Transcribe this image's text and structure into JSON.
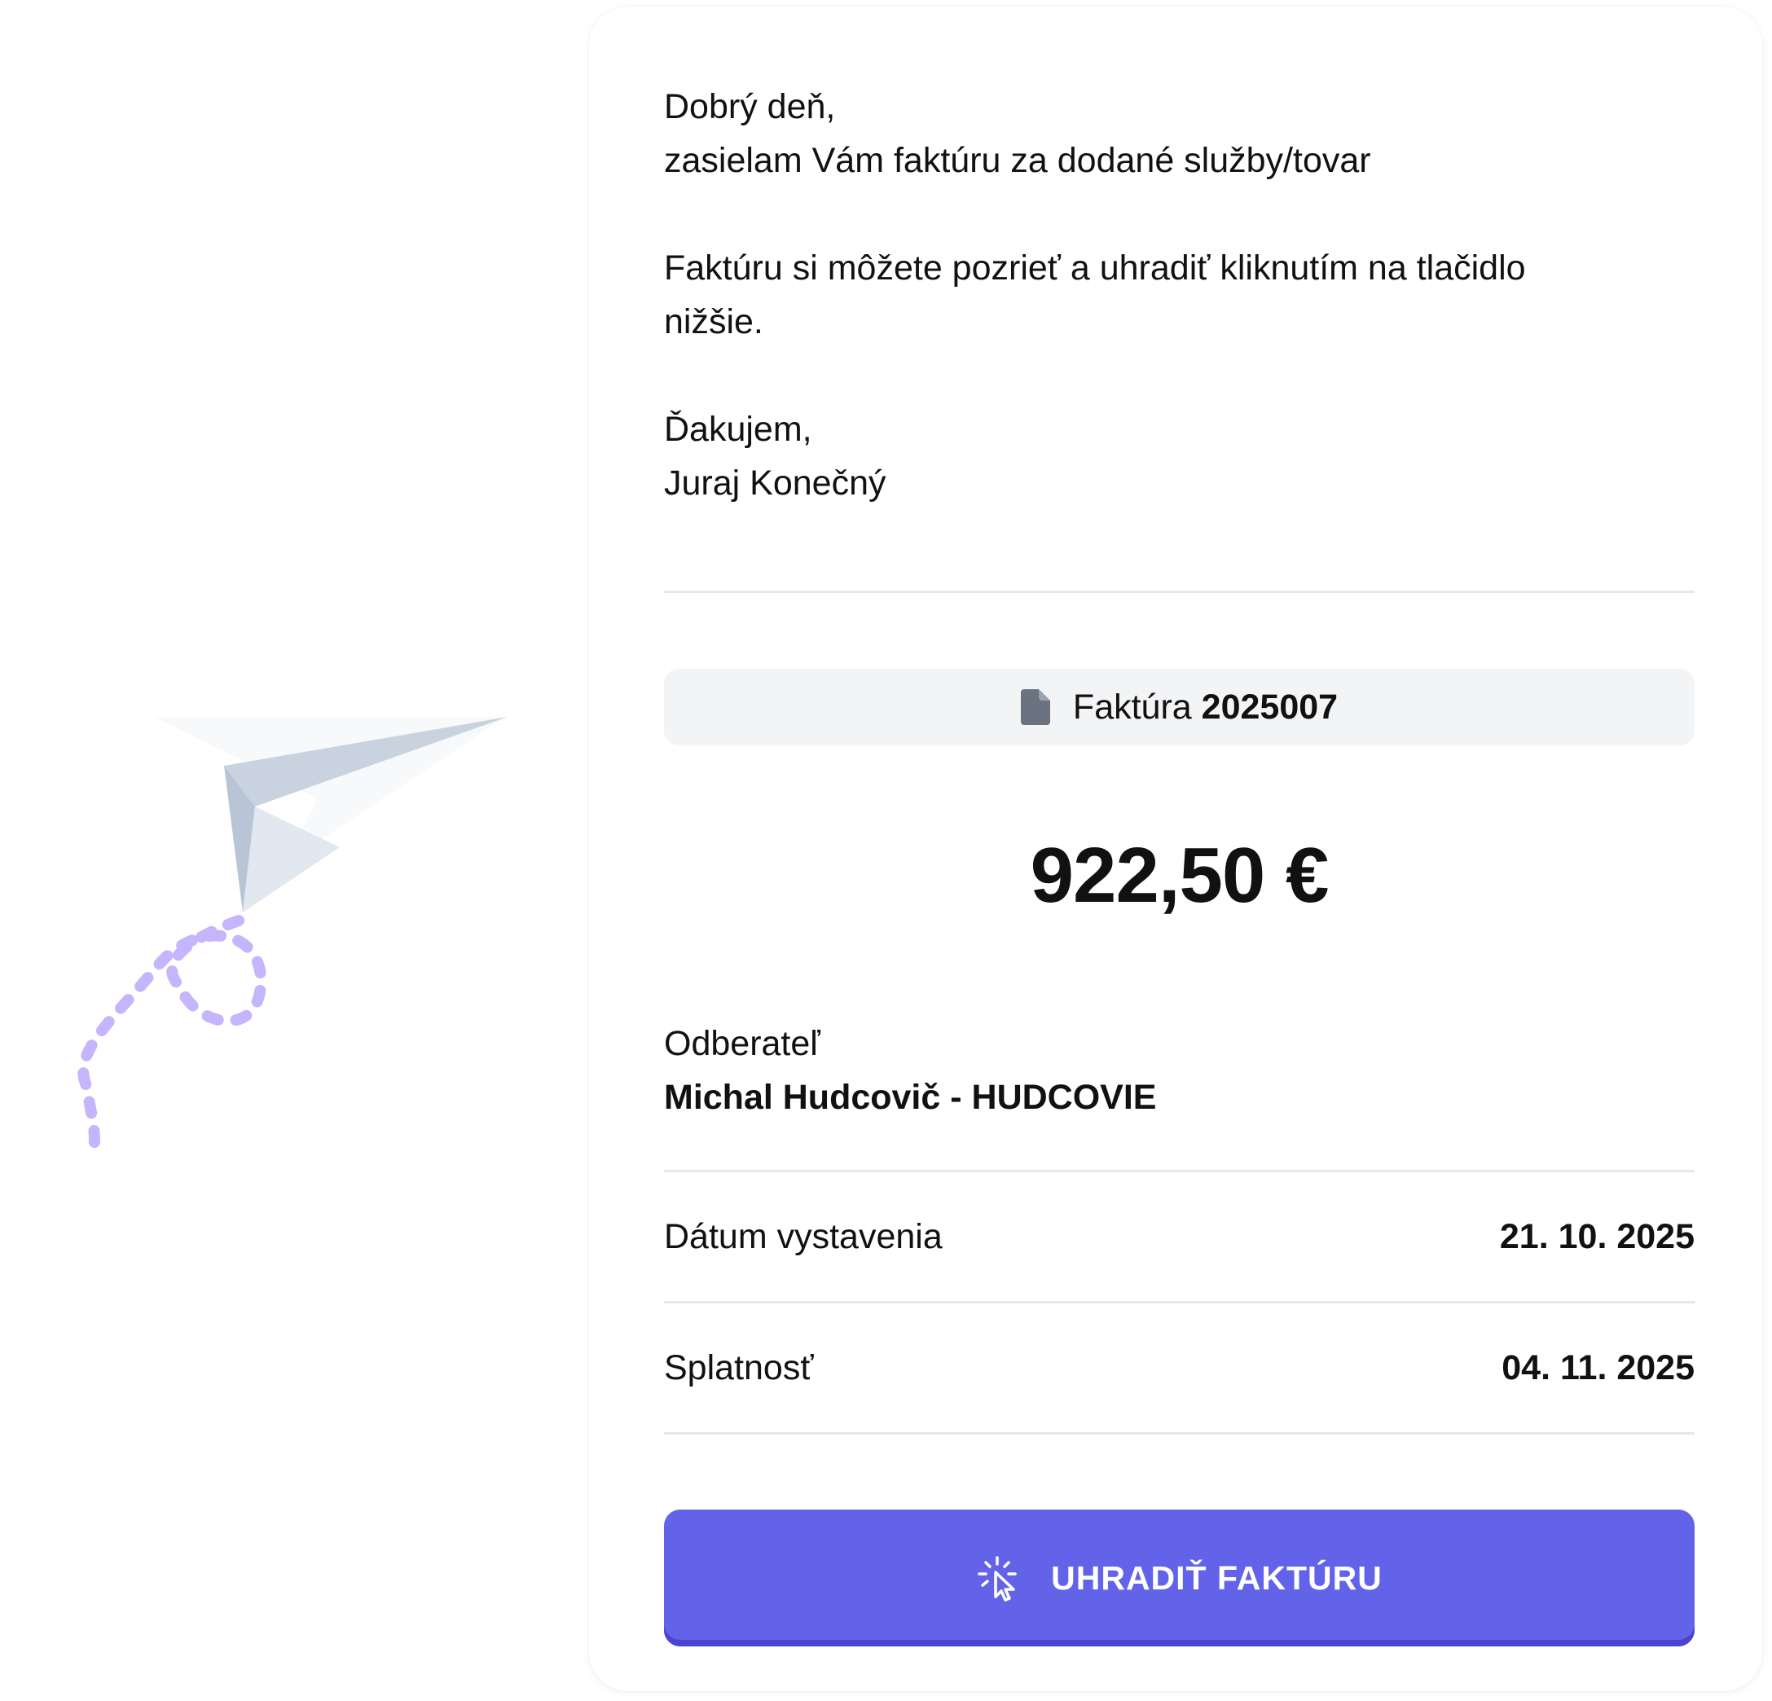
{
  "message": {
    "greeting": "Dobrý deň,",
    "line1": "zasielam Vám faktúru za dodané služby/tovar",
    "line2": "Faktúru si môžete pozrieť a uhradiť kliknutím na tlačidlo",
    "line3": "nižšie.",
    "thanks": "Ďakujem,",
    "sender": "Juraj Konečný"
  },
  "invoice": {
    "icon": "document-icon",
    "label": "Faktúra",
    "number": "2025007"
  },
  "amount": "922,50 €",
  "customer": {
    "label": "Odberateľ",
    "name": "Michal Hudcovič - HUDCOVIE"
  },
  "details": [
    {
      "label": "Dátum vystavenia",
      "value": "21. 10. 2025"
    },
    {
      "label": "Splatnosť",
      "value": "04. 11. 2025"
    }
  ],
  "pay_button": {
    "icon": "click-cursor-icon",
    "label": "UHRADIŤ FAKTÚRU"
  },
  "colors": {
    "accent": "#6363ea",
    "accent_shadow": "#4a44cf",
    "pill_bg": "#f3f4f6",
    "divider": "#e6e7ea",
    "dashed_trail": "#c4b5fd"
  }
}
